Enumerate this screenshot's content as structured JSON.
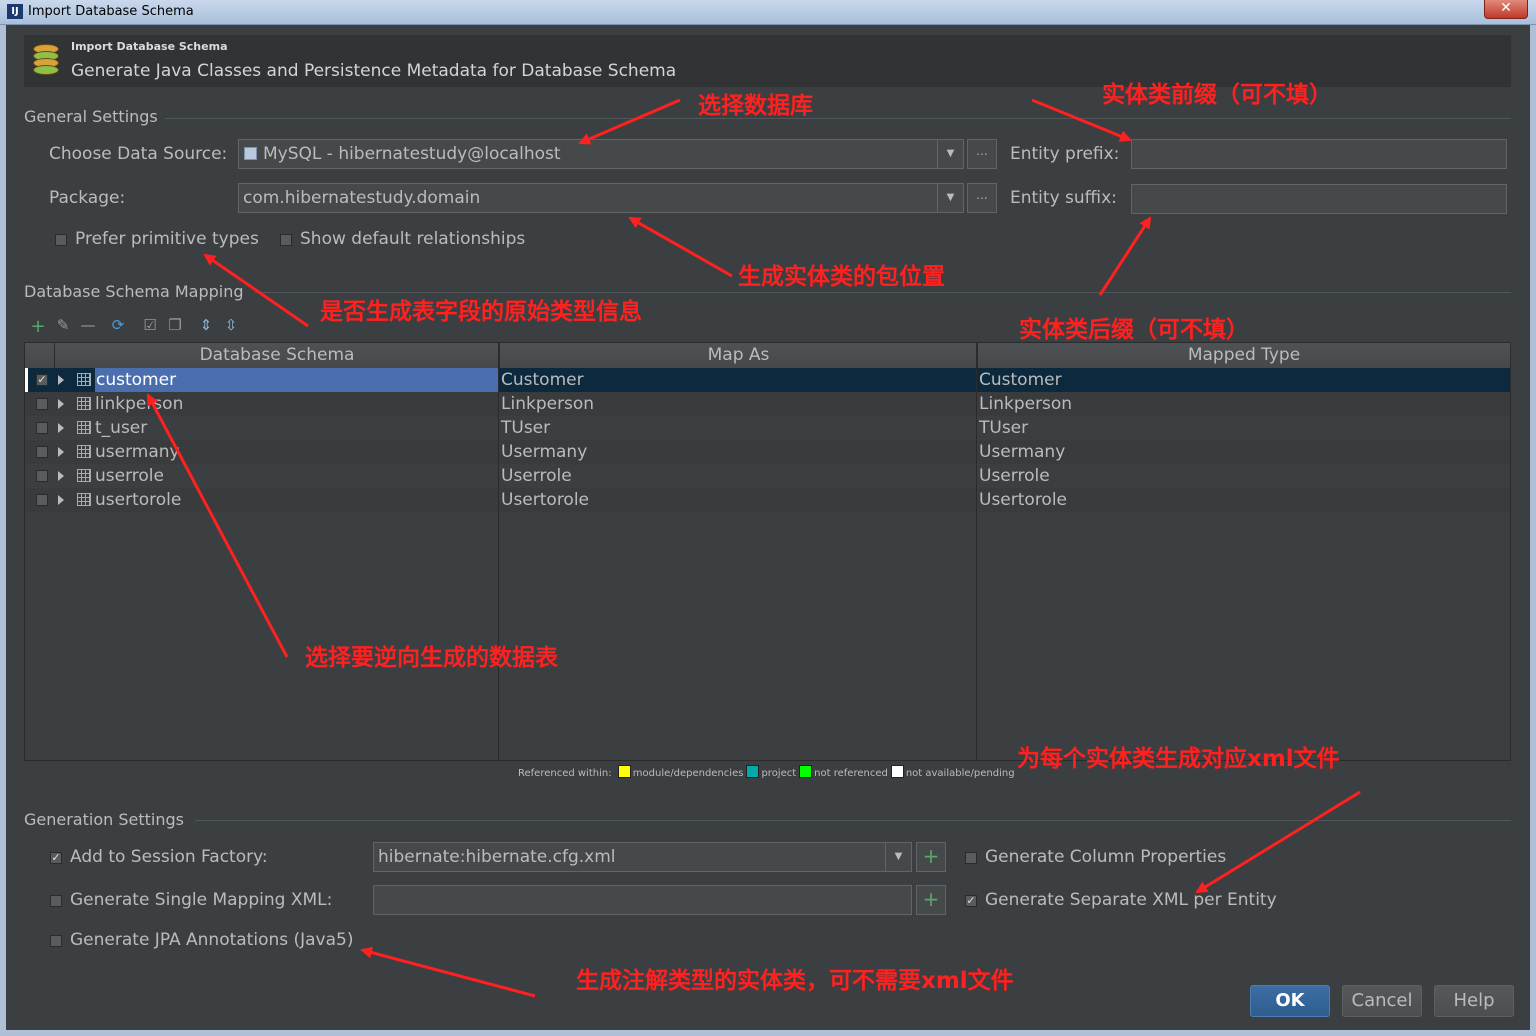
{
  "window": {
    "title": "Import Database Schema",
    "close_label": "✕"
  },
  "header": {
    "small_title": "Import Database Schema",
    "subtitle": "Generate Java Classes and Persistence Metadata for Database Schema"
  },
  "general": {
    "section": "General Settings",
    "data_source_label": "Choose Data Source:",
    "data_source_value": "MySQL - hibernatestudy@localhost",
    "package_label": "Package:",
    "package_value": "com.hibernatestudy.domain",
    "entity_prefix_label": "Entity prefix:",
    "entity_prefix_value": "",
    "entity_suffix_label": "Entity suffix:",
    "entity_suffix_value": "",
    "prefer_primitive": "Prefer primitive types",
    "show_default_rel": "Show default relationships",
    "browse_label": "..."
  },
  "mapping": {
    "section": "Database Schema Mapping",
    "columns": [
      "Database Schema",
      "Map As",
      "Mapped Type"
    ],
    "rows": [
      {
        "schema": "customer",
        "map_as": "Customer",
        "type": "Customer",
        "checked": true,
        "selected": true
      },
      {
        "schema": "linkperson",
        "map_as": "Linkperson",
        "type": "Linkperson",
        "checked": false
      },
      {
        "schema": "t_user",
        "map_as": "TUser",
        "type": "TUser",
        "checked": false
      },
      {
        "schema": "usermany",
        "map_as": "Usermany",
        "type": "Usermany",
        "checked": false
      },
      {
        "schema": "userrole",
        "map_as": "Userrole",
        "type": "Userrole",
        "checked": false
      },
      {
        "schema": "usertorole",
        "map_as": "Usertorole",
        "type": "Usertorole",
        "checked": false
      }
    ],
    "legend": {
      "prefix": "Referenced within:",
      "items": [
        {
          "label": "module/dependencies",
          "color": "#ffff00"
        },
        {
          "label": "project",
          "color": "#00aaaa"
        },
        {
          "label": "not referenced",
          "color": "#00ff00"
        },
        {
          "label": "not available/pending",
          "color": "#ffffff"
        }
      ]
    }
  },
  "generation": {
    "section": "Generation Settings",
    "add_session_factory": "Add to Session Factory:",
    "session_factory_value": "hibernate:hibernate.cfg.xml",
    "single_mapping": "Generate Single Mapping XML:",
    "single_mapping_value": "",
    "jpa": "Generate JPA Annotations (Java5)",
    "column_props": "Generate Column Properties",
    "separate_xml": "Generate Separate XML per Entity"
  },
  "buttons": {
    "ok": "OK",
    "cancel": "Cancel",
    "help": "Help"
  },
  "annotations": {
    "select_db": "选择数据库",
    "prefix_note": "实体类前缀（可不填）",
    "package_note": "生成实体类的包位置",
    "primitive_note": "是否生成表字段的原始类型信息",
    "suffix_note": "实体类后缀（可不填）",
    "tables_note": "选择要逆向生成的数据表",
    "xml_note": "为每个实体类生成对应xml文件",
    "jpa_note": "生成注解类型的实体类，可不需要xml文件"
  },
  "colors": {
    "background": "#3c3f41",
    "selection": "#4b6eaf",
    "annotation": "#ff2020",
    "accent_green": "#59a869"
  }
}
